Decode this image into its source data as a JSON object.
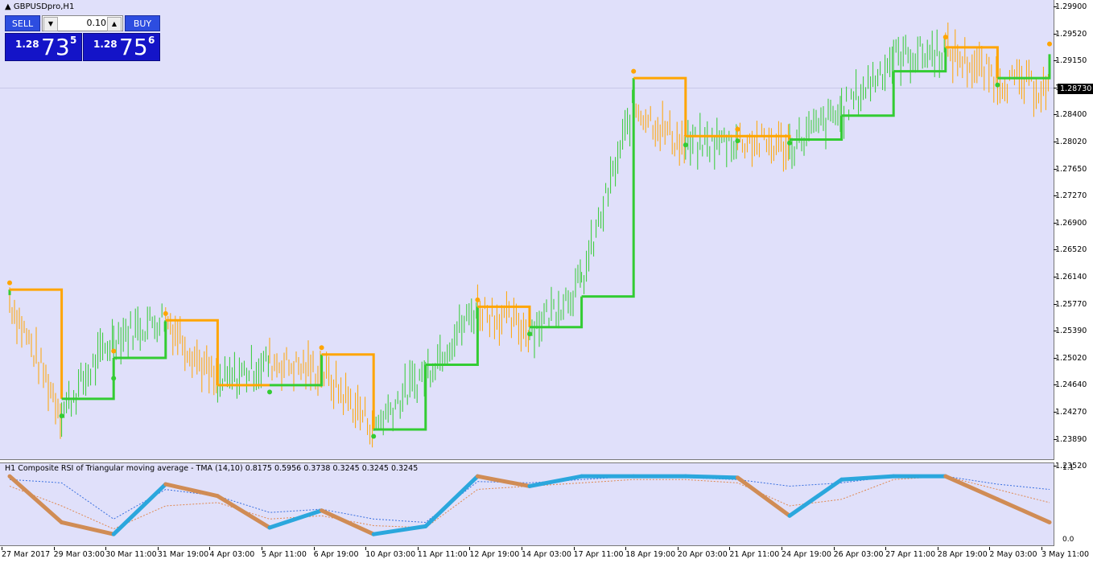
{
  "window": {
    "title": "GBPUSDpro,H1",
    "title_icon": "triangle-up-icon"
  },
  "trade_panel": {
    "sell_label": "SELL",
    "buy_label": "BUY",
    "lot": "0.10",
    "sell_price": {
      "big": "1.28",
      "pips": "73",
      "fraction": "5"
    },
    "buy_price": {
      "big": "1.28",
      "pips": "75",
      "fraction": "6"
    }
  },
  "current_price": "1.28730",
  "price_ticks": [
    "1.29900",
    "1.29520",
    "1.29150",
    "1.28780",
    "1.28400",
    "1.28020",
    "1.27650",
    "1.27270",
    "1.26900",
    "1.26520",
    "1.26140",
    "1.25770",
    "1.25390",
    "1.25020",
    "1.24640",
    "1.24270",
    "1.23890",
    "1.23520"
  ],
  "time_ticks": [
    "27 Mar 2017",
    "29 Mar 03:00",
    "30 Mar 11:00",
    "31 Mar 19:00",
    "4 Apr 03:00",
    "5 Apr 11:00",
    "6 Apr 19:00",
    "10 Apr 03:00",
    "11 Apr 11:00",
    "12 Apr 19:00",
    "14 Apr 03:00",
    "17 Apr 11:00",
    "18 Apr 19:00",
    "20 Apr 03:00",
    "21 Apr 11:00",
    "24 Apr 19:00",
    "26 Apr 03:00",
    "27 Apr 11:00",
    "28 Apr 19:00",
    "2 May 03:00",
    "3 May 11:00"
  ],
  "indicator": {
    "label": "H1 Composite RSI of Triangular moving average - TMA (14,10) 0.8175 0.5956 0.3738 0.3245 0.3245 0.3245",
    "tick_top": "1.1",
    "tick_bottom": "0.0"
  },
  "colors": {
    "up": "#33cc33",
    "down": "#ffa500",
    "background": "#e0e0fa",
    "rsi_up": "#2ba7dd",
    "rsi_down": "#d08c55",
    "rsi_flat": "#a0a0a0"
  },
  "chart_data": [
    {
      "type": "line",
      "symbol": "GBPUSDpro",
      "timeframe": "H1",
      "ylim": [
        1.2335,
        1.2995
      ],
      "stop_line": [
        {
          "x": "27 Mar 2017",
          "y": 1.2572,
          "trend": "up"
        },
        {
          "x": "27 Mar 2017",
          "y": 1.258,
          "trend": "down"
        },
        {
          "x": "29 Mar 03:00",
          "y": 1.242,
          "trend": "down"
        },
        {
          "x": "29 Mar 03:00",
          "y": 1.242,
          "trend": "up"
        },
        {
          "x": "30 Mar 11:00",
          "y": 1.248,
          "trend": "up"
        },
        {
          "x": "31 Mar 19:00",
          "y": 1.2535,
          "trend": "down"
        },
        {
          "x": "4 Apr 03:00",
          "y": 1.244,
          "trend": "down"
        },
        {
          "x": "5 Apr 11:00",
          "y": 1.244,
          "trend": "up"
        },
        {
          "x": "6 Apr 19:00",
          "y": 1.2485,
          "trend": "down"
        },
        {
          "x": "10 Apr 03:00",
          "y": 1.2375,
          "trend": "down"
        },
        {
          "x": "10 Apr 03:00",
          "y": 1.2375,
          "trend": "up"
        },
        {
          "x": "11 Apr 11:00",
          "y": 1.247,
          "trend": "up"
        },
        {
          "x": "12 Apr 19:00",
          "y": 1.2555,
          "trend": "down"
        },
        {
          "x": "14 Apr 03:00",
          "y": 1.253,
          "trend": "down"
        },
        {
          "x": "14 Apr 03:00",
          "y": 1.2525,
          "trend": "up"
        },
        {
          "x": "17 Apr 11:00",
          "y": 1.257,
          "trend": "up"
        },
        {
          "x": "18 Apr 19:00",
          "y": 1.289,
          "trend": "up"
        },
        {
          "x": "18 Apr 19:00",
          "y": 1.289,
          "trend": "down"
        },
        {
          "x": "20 Apr 03:00",
          "y": 1.2805,
          "trend": "down"
        },
        {
          "x": "21 Apr 11:00",
          "y": 1.2805,
          "trend": "down"
        },
        {
          "x": "24 Apr 19:00",
          "y": 1.28,
          "trend": "up"
        },
        {
          "x": "26 Apr 03:00",
          "y": 1.2835,
          "trend": "up"
        },
        {
          "x": "27 Apr 11:00",
          "y": 1.29,
          "trend": "up"
        },
        {
          "x": "28 Apr 19:00",
          "y": 1.2935,
          "trend": "down"
        },
        {
          "x": "2 May 03:00",
          "y": 1.289,
          "trend": "up"
        },
        {
          "x": "3 May 11:00",
          "y": 1.2925,
          "trend": "down"
        }
      ],
      "price": [
        {
          "x": "27 Mar 2017",
          "y": 1.2565
        },
        {
          "x": "29 Mar 03:00",
          "y": 1.24
        },
        {
          "x": "30 Mar 11:00",
          "y": 1.251
        },
        {
          "x": "31 Mar 19:00",
          "y": 1.254
        },
        {
          "x": "4 Apr 03:00",
          "y": 1.244
        },
        {
          "x": "5 Apr 11:00",
          "y": 1.2475
        },
        {
          "x": "6 Apr 19:00",
          "y": 1.246
        },
        {
          "x": "10 Apr 03:00",
          "y": 1.238
        },
        {
          "x": "11 Apr 11:00",
          "y": 1.246
        },
        {
          "x": "12 Apr 19:00",
          "y": 1.2555
        },
        {
          "x": "14 Apr 03:00",
          "y": 1.252
        },
        {
          "x": "17 Apr 11:00",
          "y": 1.259
        },
        {
          "x": "18 Apr 19:00",
          "y": 1.285
        },
        {
          "x": "20 Apr 03:00",
          "y": 1.279
        },
        {
          "x": "21 Apr 11:00",
          "y": 1.28
        },
        {
          "x": "24 Apr 19:00",
          "y": 1.279
        },
        {
          "x": "26 Apr 03:00",
          "y": 1.284
        },
        {
          "x": "27 Apr 11:00",
          "y": 1.292
        },
        {
          "x": "28 Apr 19:00",
          "y": 1.293
        },
        {
          "x": "2 May 03:00",
          "y": 1.289
        },
        {
          "x": "3 May 11:00",
          "y": 1.2873
        }
      ],
      "signal_dots": [
        {
          "x": "27 Mar 2017",
          "y": 1.259,
          "color": "orange"
        },
        {
          "x": "29 Mar 03:00",
          "y": 1.2395,
          "color": "green"
        },
        {
          "x": "30 Mar 11:00",
          "y": 1.249,
          "color": "orange"
        },
        {
          "x": "30 Mar 11:00",
          "y": 1.245,
          "color": "green"
        },
        {
          "x": "31 Mar 19:00",
          "y": 1.2545,
          "color": "orange"
        },
        {
          "x": "5 Apr 11:00",
          "y": 1.243,
          "color": "green"
        },
        {
          "x": "6 Apr 19:00",
          "y": 1.2495,
          "color": "orange"
        },
        {
          "x": "10 Apr 03:00",
          "y": 1.2365,
          "color": "green"
        },
        {
          "x": "12 Apr 19:00",
          "y": 1.2565,
          "color": "orange"
        },
        {
          "x": "14 Apr 03:00",
          "y": 1.2515,
          "color": "green"
        },
        {
          "x": "18 Apr 19:00",
          "y": 1.29,
          "color": "orange"
        },
        {
          "x": "20 Apr 03:00",
          "y": 1.2792,
          "color": "green"
        },
        {
          "x": "21 Apr 11:00",
          "y": 1.2815,
          "color": "orange"
        },
        {
          "x": "21 Apr 11:00",
          "y": 1.2798,
          "color": "green"
        },
        {
          "x": "24 Apr 19:00",
          "y": 1.2795,
          "color": "green"
        },
        {
          "x": "28 Apr 19:00",
          "y": 1.295,
          "color": "orange"
        },
        {
          "x": "2 May 03:00",
          "y": 1.288,
          "color": "green"
        },
        {
          "x": "3 May 11:00",
          "y": 1.294,
          "color": "orange"
        }
      ]
    },
    {
      "type": "line",
      "title": "H1 Composite RSI of Triangular moving average - TMA (14,10)",
      "ylim": [
        0.0,
        1.1
      ],
      "rsi": [
        {
          "x": "27 Mar 2017",
          "y": 1.0
        },
        {
          "x": "29 Mar 03:00",
          "y": 0.3
        },
        {
          "x": "30 Mar 11:00",
          "y": 0.12
        },
        {
          "x": "31 Mar 19:00",
          "y": 0.88
        },
        {
          "x": "4 Apr 03:00",
          "y": 0.7
        },
        {
          "x": "5 Apr 11:00",
          "y": 0.22
        },
        {
          "x": "6 Apr 19:00",
          "y": 0.48
        },
        {
          "x": "10 Apr 03:00",
          "y": 0.12
        },
        {
          "x": "11 Apr 11:00",
          "y": 0.24
        },
        {
          "x": "12 Apr 19:00",
          "y": 1.0
        },
        {
          "x": "14 Apr 03:00",
          "y": 0.85
        },
        {
          "x": "17 Apr 11:00",
          "y": 1.0
        },
        {
          "x": "18 Apr 19:00",
          "y": 1.0
        },
        {
          "x": "20 Apr 03:00",
          "y": 1.0
        },
        {
          "x": "21 Apr 11:00",
          "y": 0.98
        },
        {
          "x": "24 Apr 19:00",
          "y": 0.4
        },
        {
          "x": "26 Apr 03:00",
          "y": 0.95
        },
        {
          "x": "27 Apr 11:00",
          "y": 1.0
        },
        {
          "x": "28 Apr 19:00",
          "y": 1.0
        },
        {
          "x": "2 May 03:00",
          "y": 0.65
        },
        {
          "x": "3 May 11:00",
          "y": 0.3
        }
      ],
      "signal_fast": [
        {
          "x": "27 Mar 2017",
          "y": 0.95
        },
        {
          "x": "29 Mar 03:00",
          "y": 0.9
        },
        {
          "x": "30 Mar 11:00",
          "y": 0.35
        },
        {
          "x": "31 Mar 19:00",
          "y": 0.8
        },
        {
          "x": "4 Apr 03:00",
          "y": 0.7
        },
        {
          "x": "5 Apr 11:00",
          "y": 0.45
        },
        {
          "x": "6 Apr 19:00",
          "y": 0.5
        },
        {
          "x": "10 Apr 03:00",
          "y": 0.35
        },
        {
          "x": "11 Apr 11:00",
          "y": 0.3
        },
        {
          "x": "12 Apr 19:00",
          "y": 0.92
        },
        {
          "x": "14 Apr 03:00",
          "y": 0.9
        },
        {
          "x": "17 Apr 11:00",
          "y": 0.95
        },
        {
          "x": "18 Apr 19:00",
          "y": 1.0
        },
        {
          "x": "20 Apr 03:00",
          "y": 0.98
        },
        {
          "x": "21 Apr 11:00",
          "y": 0.95
        },
        {
          "x": "24 Apr 19:00",
          "y": 0.85
        },
        {
          "x": "26 Apr 03:00",
          "y": 0.9
        },
        {
          "x": "27 Apr 11:00",
          "y": 1.0
        },
        {
          "x": "28 Apr 19:00",
          "y": 1.0
        },
        {
          "x": "2 May 03:00",
          "y": 0.88
        },
        {
          "x": "3 May 11:00",
          "y": 0.8
        }
      ],
      "signal_slow": [
        {
          "x": "27 Mar 2017",
          "y": 0.85
        },
        {
          "x": "29 Mar 03:00",
          "y": 0.55
        },
        {
          "x": "30 Mar 11:00",
          "y": 0.2
        },
        {
          "x": "31 Mar 19:00",
          "y": 0.55
        },
        {
          "x": "4 Apr 03:00",
          "y": 0.6
        },
        {
          "x": "5 Apr 11:00",
          "y": 0.35
        },
        {
          "x": "6 Apr 19:00",
          "y": 0.4
        },
        {
          "x": "10 Apr 03:00",
          "y": 0.25
        },
        {
          "x": "11 Apr 11:00",
          "y": 0.22
        },
        {
          "x": "12 Apr 19:00",
          "y": 0.8
        },
        {
          "x": "14 Apr 03:00",
          "y": 0.85
        },
        {
          "x": "17 Apr 11:00",
          "y": 0.9
        },
        {
          "x": "18 Apr 19:00",
          "y": 0.95
        },
        {
          "x": "20 Apr 03:00",
          "y": 0.95
        },
        {
          "x": "21 Apr 11:00",
          "y": 0.9
        },
        {
          "x": "24 Apr 19:00",
          "y": 0.55
        },
        {
          "x": "26 Apr 03:00",
          "y": 0.65
        },
        {
          "x": "27 Apr 11:00",
          "y": 0.95
        },
        {
          "x": "28 Apr 19:00",
          "y": 1.0
        },
        {
          "x": "2 May 03:00",
          "y": 0.8
        },
        {
          "x": "3 May 11:00",
          "y": 0.6
        }
      ]
    }
  ]
}
